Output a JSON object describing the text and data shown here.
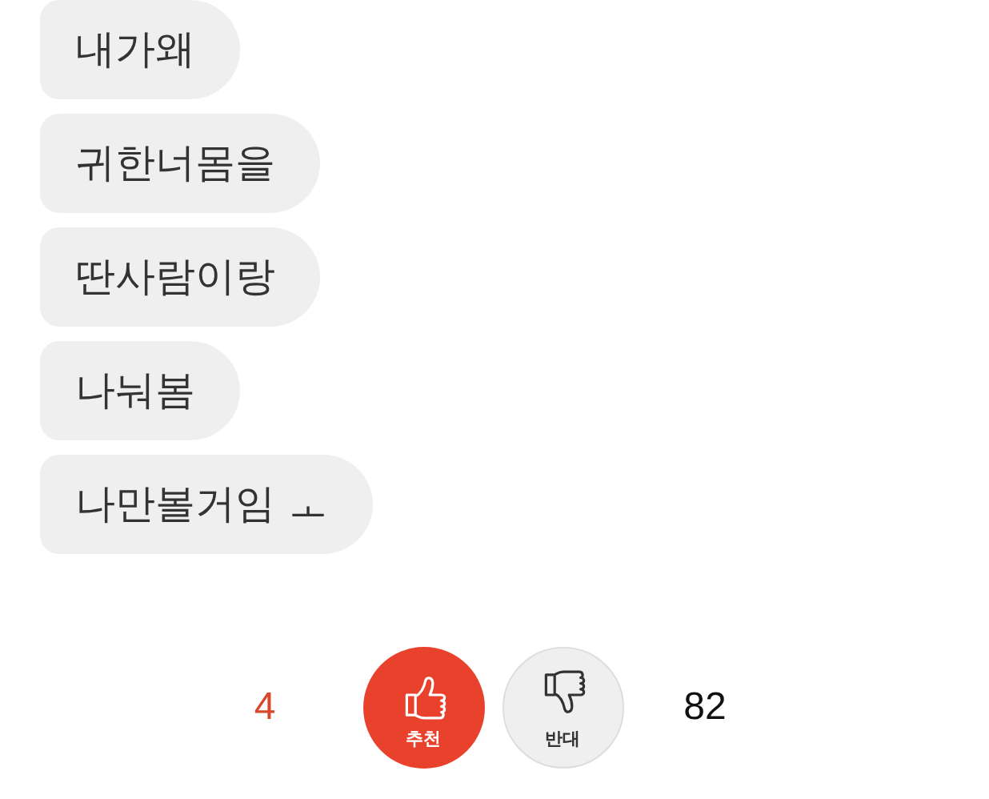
{
  "messages": [
    {
      "text": "내가왜"
    },
    {
      "text": "귀한너몸을"
    },
    {
      "text": "딴사람이랑"
    },
    {
      "text": "나눠봄"
    },
    {
      "text": "나만볼거임 ㅗ"
    }
  ],
  "votes": [
    {
      "kind": "up",
      "label": "추천",
      "count": "4"
    },
    {
      "kind": "down",
      "label": "반대",
      "count": "82"
    }
  ]
}
